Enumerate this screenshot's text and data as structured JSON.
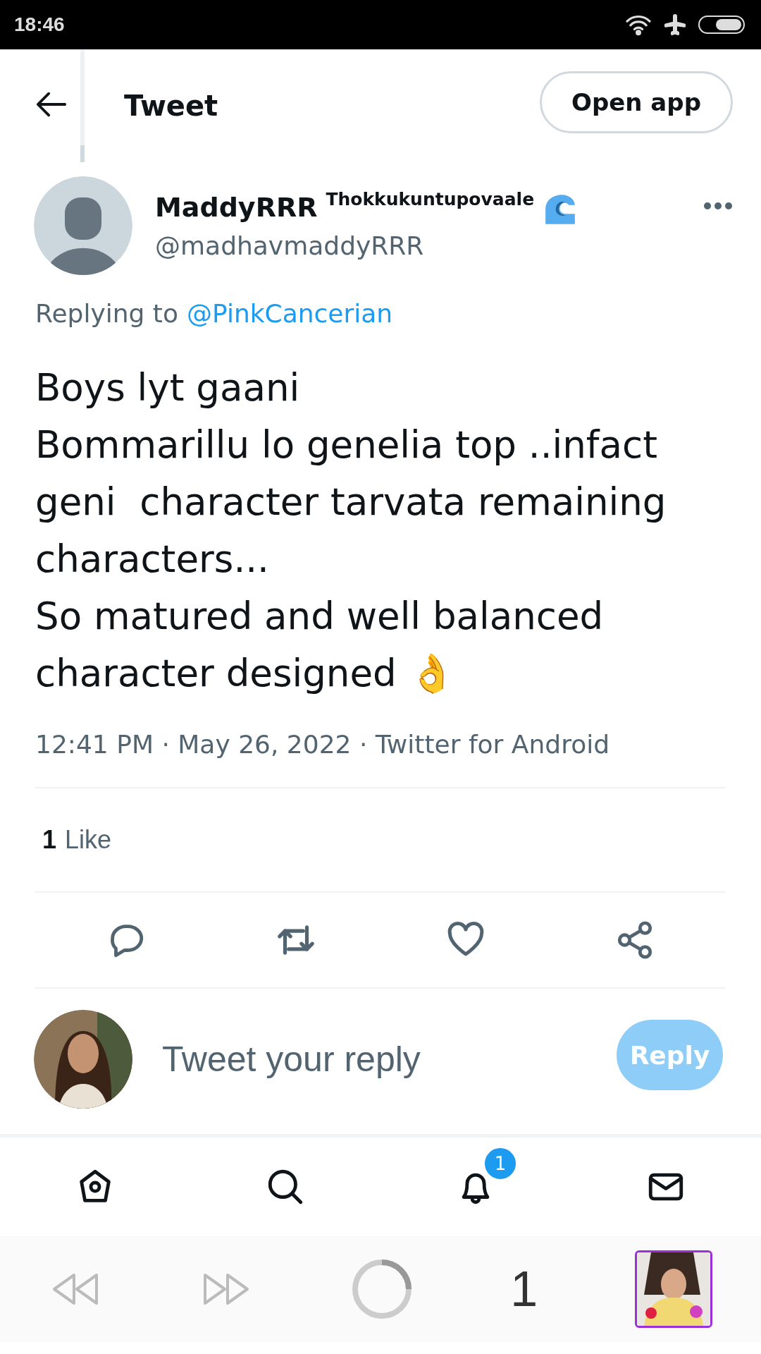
{
  "status_bar": {
    "time": "18:46"
  },
  "header": {
    "title": "Tweet",
    "open_app": "Open app"
  },
  "author": {
    "name": "MaddyRRR",
    "name_suffix": "Thokkukuntupovaale",
    "handle": "@madhavmaddyRRR"
  },
  "replying_to": {
    "label": "Replying to",
    "handle": "@PinkCancerian"
  },
  "tweet": {
    "text": "Boys lyt gaani\nBommarillu lo genelia top ..infact geni  character tarvata remaining characters...\nSo matured and well balanced character designed 👌",
    "meta": "12:41 PM · May 26, 2022 · Twitter for Android"
  },
  "stats": {
    "count": "1",
    "label": "Like"
  },
  "composer": {
    "placeholder": "Tweet your reply",
    "button": "Reply",
    "button_disabled": true
  },
  "bottom_nav": [
    {
      "kind": "home"
    },
    {
      "kind": "search"
    },
    {
      "kind": "notifications",
      "badge": "1"
    },
    {
      "kind": "messages"
    }
  ],
  "browser_bar": {
    "tab_count": "1"
  }
}
